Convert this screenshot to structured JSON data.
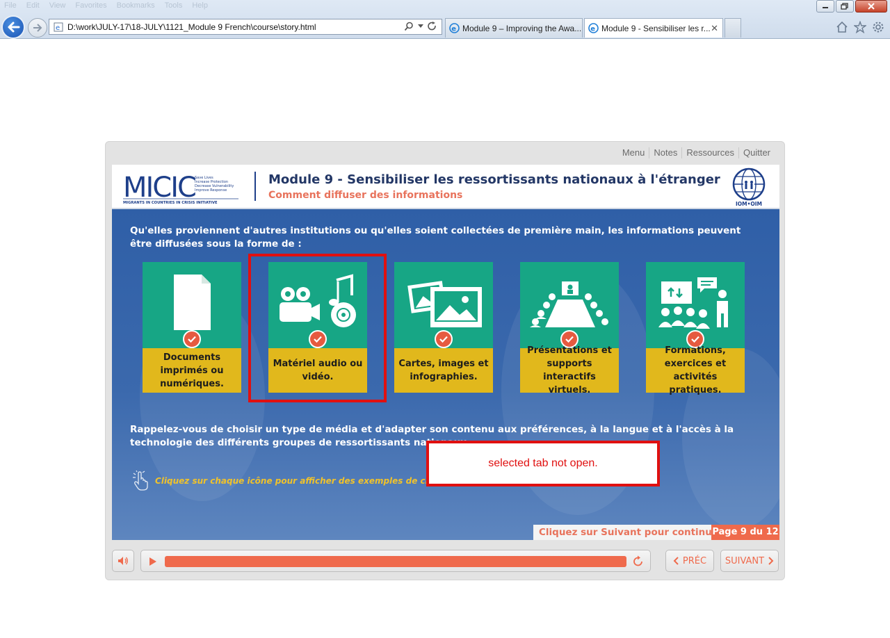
{
  "browser": {
    "menu": [
      "File",
      "Edit",
      "View",
      "Favorites",
      "Bookmarks",
      "Tools",
      "Help"
    ],
    "address": "D:\\work\\JULY-17\\18-JULY\\1121_Module 9 French\\course\\story.html",
    "tabs": [
      {
        "label": "Module 9 – Improving the Awa..."
      },
      {
        "label": "Module 9 - Sensibiliser les r..."
      }
    ]
  },
  "player": {
    "topmenu": [
      "Menu",
      "Notes",
      "Ressources",
      "Quitter"
    ],
    "header": {
      "logo_text": "MICIC",
      "logo_tagline": [
        "Save Lives",
        "Increase Protection",
        "Decrease Vulnerability",
        "Improve Response"
      ],
      "logo_subtitle": "MIGRANTS IN COUNTRIES IN CRISIS INITIATIVE",
      "title": "Module 9 - Sensibiliser les ressortissants nationaux à l'étranger",
      "subtitle": "Comment diffuser des informations",
      "iom_label": "IOM•OIM"
    },
    "intro": "Qu'elles proviennent d'autres institutions ou qu'elles soient collectées de première main, les informations peuvent être diffusées sous la forme de :",
    "cards": [
      {
        "label": "Documents imprimés ou numériques."
      },
      {
        "label": "Matériel audio ou vidéo."
      },
      {
        "label": "Cartes, images et infographies."
      },
      {
        "label": "Présentations et supports interactifs virtuels."
      },
      {
        "label": "Formations, exercices et activités pratiques."
      }
    ],
    "reminder": "Rappelez-vous de choisir un type de média et d'adapter son contenu aux préférences, à la langue et à l'accès à la technologie des différents groupes de ressortissants nationaux.",
    "hint": "Cliquez sur chaque icône pour afficher des exemples de chaque type de contenu.",
    "annotation": "selected tab not open.",
    "continue": "Cliquez sur Suivant pour continuer",
    "page": "Page 9 du 12",
    "controls": {
      "prev": "PRÉC",
      "next": "SUIVANT",
      "progress": 1.0
    },
    "colors": {
      "accent": "#ef6a4c",
      "card_top": "#17a685",
      "card_bottom": "#e1b81c",
      "slide_bg": "#3b69ad"
    }
  }
}
